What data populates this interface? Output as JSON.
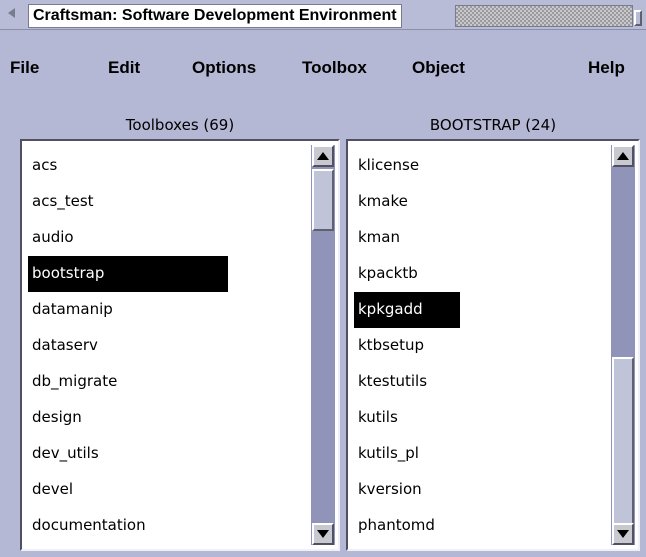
{
  "window": {
    "title": "Craftsman: Software Development Environment"
  },
  "menubar": {
    "items": [
      "File",
      "Edit",
      "Options",
      "Toolbox",
      "Object",
      "Help"
    ]
  },
  "toolboxes": {
    "header": "Toolboxes (69)",
    "items": [
      "acs",
      "acs_test",
      "audio",
      "bootstrap",
      "datamanip",
      "dataserv",
      "db_migrate",
      "design",
      "dev_utils",
      "devel",
      "documentation"
    ],
    "selected": "bootstrap"
  },
  "objects": {
    "header": "BOOTSTRAP (24)",
    "items": [
      "klicense",
      "kmake",
      "kman",
      "kpacktb",
      "kpkgadd",
      "ktbsetup",
      "ktestutils",
      "kutils",
      "kutils_pl",
      "kversion",
      "phantomd"
    ],
    "selected": "kpkgadd"
  }
}
